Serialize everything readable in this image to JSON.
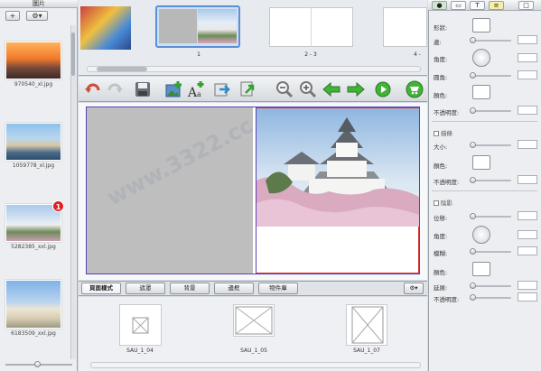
{
  "left_panel": {
    "title": "圖片",
    "add_label": "+",
    "gear_label": "⚙▾",
    "photos": [
      {
        "filename": "970540_xl.jpg"
      },
      {
        "filename": "1059778_xl.jpg"
      },
      {
        "filename": "5282385_xxl.jpg",
        "badge": "1"
      },
      {
        "filename": "6183509_xxl.jpg"
      }
    ]
  },
  "page_strip": {
    "pages": [
      "1",
      "2 - 3",
      "4 -"
    ]
  },
  "toolbar": {
    "icons": [
      "undo-icon",
      "redo-icon",
      "save-icon",
      "add-picture-icon",
      "add-text-icon",
      "export-icon",
      "share-icon",
      "zoom-out-icon",
      "zoom-in-icon",
      "previous-page-icon",
      "next-page-icon",
      "play-icon",
      "cart-icon"
    ]
  },
  "tabs": {
    "items": [
      "頁面樣式",
      "遮罩",
      "背景",
      "邊框",
      "物件庫"
    ],
    "active": "頁面樣式",
    "gear_label": "⚙▾"
  },
  "gallery": {
    "layouts": [
      "SAU_1_04",
      "SAU_1_05",
      "SAU_1_07"
    ]
  },
  "inspector": {
    "tab_icons": [
      "picture-icon",
      "frame-icon",
      "text-icon",
      "ruler-icon",
      "page-icon"
    ],
    "text_tab_label": "T",
    "shape_label": "形狀:",
    "border_label": "邊:",
    "angle_label": "角度:",
    "corner_label": "圓角:",
    "color_label": "顏色:",
    "opacity_label": "不透明度:",
    "stroke_section": "描條",
    "stroke_size_label": "大小:",
    "stroke_color_label": "顏色:",
    "stroke_opacity_label": "不透明度:",
    "shadow_section": "陰影",
    "shadow_offset_label": "位移:",
    "shadow_angle_label": "角度:",
    "shadow_blur_label": "模糊:",
    "shadow_color_label": "顏色:",
    "shadow_spread_label": "延展:",
    "shadow_opacity_label": "不透明度:"
  },
  "watermark": "www.3322.cc"
}
